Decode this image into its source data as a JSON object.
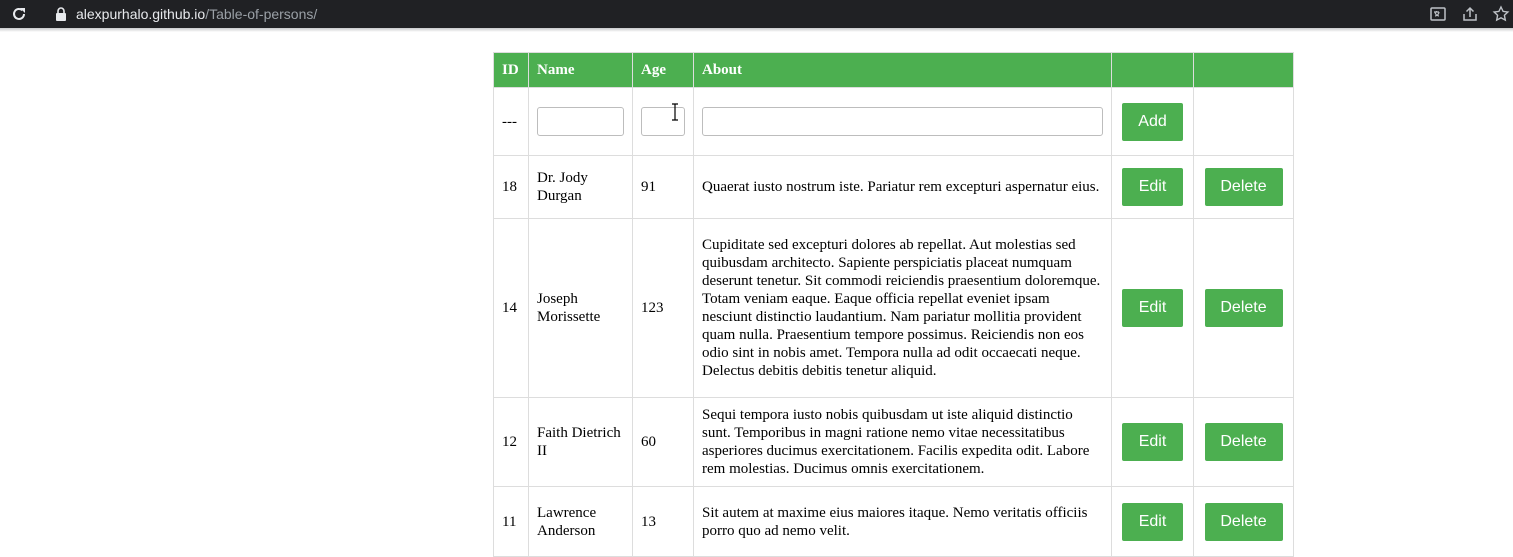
{
  "browser": {
    "url_host": "alexpurhalo.github.io",
    "url_path": "/Table-of-persons/",
    "icons": [
      "reload-icon",
      "lock-icon",
      "translate-icon",
      "share-icon",
      "bookmark-star-icon"
    ]
  },
  "colors": {
    "accent": "#4caf50",
    "border": "#dddddd",
    "topbar": "#202124"
  },
  "table": {
    "headers": [
      "ID",
      "Name",
      "Age",
      "About",
      "",
      ""
    ],
    "new_row": {
      "id": "---",
      "name_value": "",
      "age_value": "",
      "about_value": "",
      "add_label": "Add"
    },
    "rows": [
      {
        "id": "18",
        "name": "Dr. Jody Durgan",
        "age": "91",
        "about": "Quaerat iusto nostrum iste. Pariatur rem excepturi aspernatur eius.",
        "edit_label": "Edit",
        "delete_label": "Delete"
      },
      {
        "id": "14",
        "name": "Joseph Morissette",
        "age": "123",
        "about": "Cupiditate sed excepturi dolores ab repellat. Aut molestias sed quibusdam architecto. Sapiente perspiciatis placeat numquam deserunt tenetur. Sit commodi reiciendis praesentium doloremque. Totam veniam eaque. Eaque officia repellat eveniet ipsam nesciunt distinctio laudantium. Nam pariatur mollitia provident quam nulla. Praesentium tempore possimus. Reiciendis non eos odio sint in nobis amet. Tempora nulla ad odit occaecati neque. Delectus debitis debitis tenetur aliquid.",
        "edit_label": "Edit",
        "delete_label": "Delete"
      },
      {
        "id": "12",
        "name": "Faith Dietrich II",
        "age": "60",
        "about": "Sequi tempora iusto nobis quibusdam ut iste aliquid distinctio sunt. Temporibus in magni ratione nemo vitae necessitatibus asperiores ducimus exercitationem. Facilis expedita odit. Labore rem molestias. Ducimus omnis exercitationem.",
        "edit_label": "Edit",
        "delete_label": "Delete"
      },
      {
        "id": "11",
        "name": "Lawrence Anderson",
        "age": "13",
        "about": "Sit autem at maxime eius maiores itaque. Nemo veritatis officiis porro quo ad nemo velit.",
        "edit_label": "Edit",
        "delete_label": "Delete"
      }
    ]
  }
}
